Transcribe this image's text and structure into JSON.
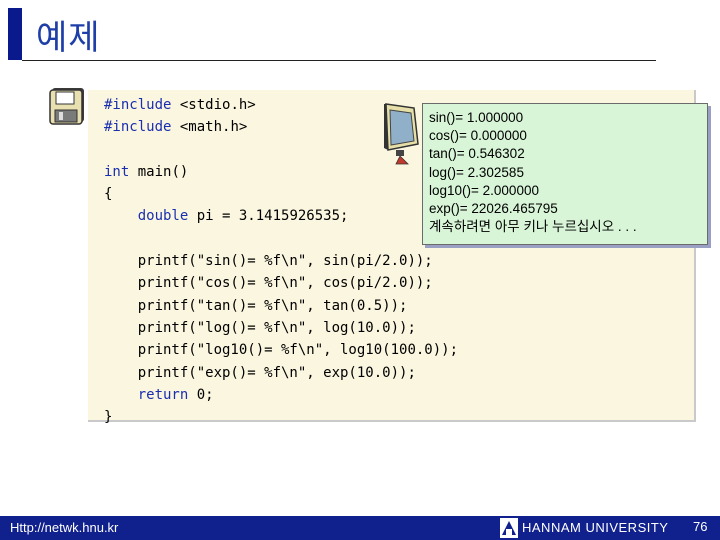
{
  "slide": {
    "title": "예제",
    "page_number": "76"
  },
  "code": {
    "lines": [
      "#include <stdio.h>",
      "#include <math.h>",
      "",
      "int main()",
      "{",
      "    double pi = 3.1415926535;",
      "",
      "    printf(\"sin()= %f\\n\", sin(pi/2.0));",
      "    printf(\"cos()= %f\\n\", cos(pi/2.0));",
      "    printf(\"tan()= %f\\n\", tan(0.5));",
      "    printf(\"log()= %f\\n\", log(10.0));",
      "    printf(\"log10()= %f\\n\", log10(100.0));",
      "    printf(\"exp()= %f\\n\", exp(10.0));",
      "    return 0;",
      "}"
    ]
  },
  "output": {
    "lines": [
      "sin()= 1.000000",
      "cos()= 0.000000",
      "tan()= 0.546302",
      "log()= 2.302585",
      "log10()= 2.000000",
      "exp()= 22026.465795",
      "계속하려면 아무 키나 누르십시오 . . ."
    ]
  },
  "footer": {
    "url": "Http://netwk.hnu.kr",
    "university": "HANNAM UNIVERSITY"
  },
  "icons": {
    "disk": "floppy-disk-icon",
    "monitor": "monitor-icon",
    "logo": "university-logo-icon"
  },
  "colors": {
    "title": "#1f3fa8",
    "footer_bg": "#10208c",
    "code_bg": "#fbf6df",
    "output_bg": "#d8f5d8",
    "keyword": "#1a2fb0"
  }
}
